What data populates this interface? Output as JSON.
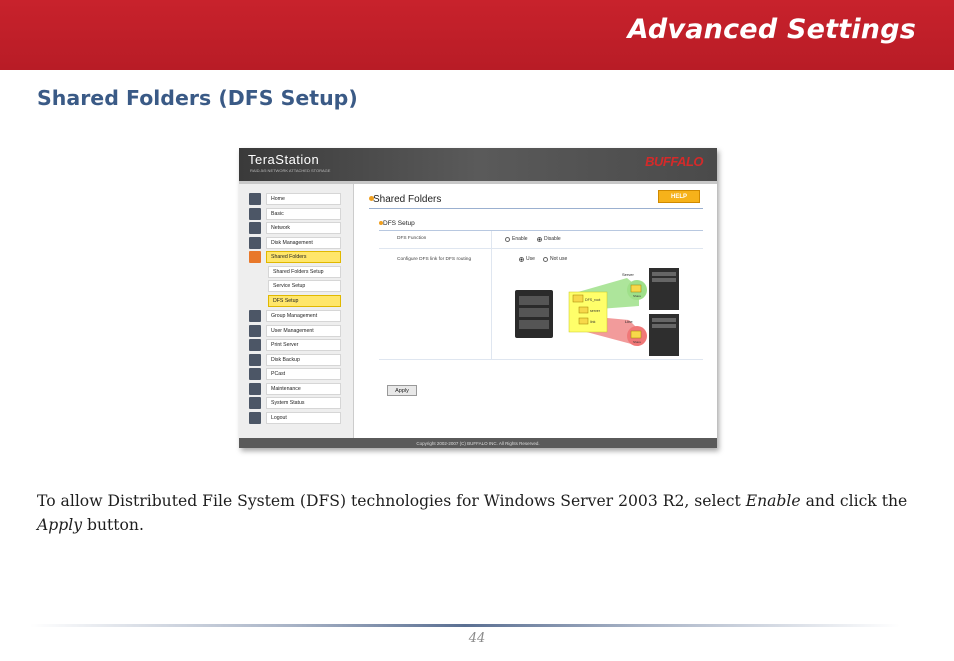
{
  "header": {
    "title": "Advanced Settings"
  },
  "section": {
    "title": "Shared Folders (DFS Setup)"
  },
  "screenshot": {
    "brand": "TeraStation",
    "brand_sub": "RAID-5/5 NETWORK ATTACHED STORAGE",
    "vendor": "BUFFALO",
    "nav": [
      {
        "label": "Home"
      },
      {
        "label": "Basic"
      },
      {
        "label": "Network"
      },
      {
        "label": "Disk Management"
      },
      {
        "label": "Shared Folders"
      },
      {
        "label": "Shared Folders Setup"
      },
      {
        "label": "Service Setup"
      },
      {
        "label": "DFS Setup"
      },
      {
        "label": "Group Management"
      },
      {
        "label": "User Management"
      },
      {
        "label": "Print Server"
      },
      {
        "label": "Disk Backup"
      },
      {
        "label": "PCast"
      },
      {
        "label": "Maintenance"
      },
      {
        "label": "System Status"
      },
      {
        "label": "Logout"
      }
    ],
    "page_title": "Shared Folders",
    "help": "HELP",
    "dfs_title": "DFS Setup",
    "dfs_function_label": "DFS Function",
    "enable": "Enable",
    "disable": "Disable",
    "configure_label": "Configure DFS link for DFS routing",
    "use": "Use",
    "not_use": "Not use",
    "diagram": {
      "server1": "Server",
      "server2": "Line",
      "share1": "Share",
      "share2": "Share",
      "folder_root": "DFS_root",
      "folder_server": "server",
      "folder_link": "link"
    },
    "apply": "Apply",
    "copyright": "Copyright 2002-2007 (C) BUFFALO INC. All Rights Reserved."
  },
  "body": {
    "text_1": "To allow Distributed File System (DFS) technologies for Windows Server 2003 R2, select ",
    "em_1": "Enable",
    "text_2": " and click the ",
    "em_2": "Apply",
    "text_3": " button."
  },
  "footer": {
    "page_number": "44"
  }
}
